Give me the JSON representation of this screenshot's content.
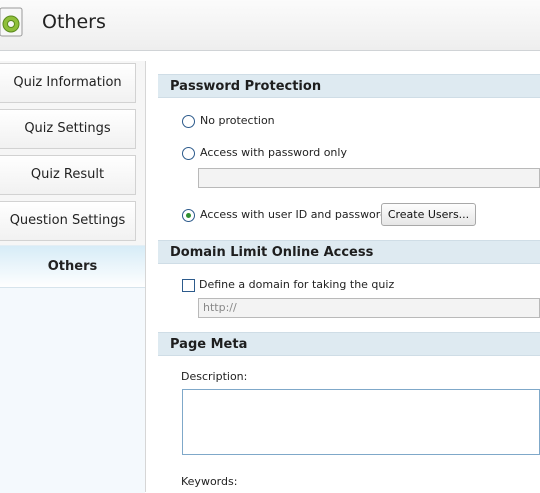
{
  "window": {
    "title": "Others",
    "icon": "gear-document-icon"
  },
  "nav": {
    "items": [
      {
        "label": "Quiz Information"
      },
      {
        "label": "Quiz Settings"
      },
      {
        "label": "Quiz Result"
      },
      {
        "label": "Question Settings"
      },
      {
        "label": "Others",
        "active": true
      }
    ]
  },
  "password_protection": {
    "header": "Password Protection",
    "options": [
      {
        "label": "No protection",
        "selected": false
      },
      {
        "label": "Access with password only",
        "selected": false
      },
      {
        "label": "Access with user ID and password",
        "selected": true
      }
    ],
    "password_value": "",
    "create_users_label": "Create Users..."
  },
  "domain_limit": {
    "header": "Domain Limit Online Access",
    "checkbox_label": "Define a domain for taking the quiz",
    "checked": false,
    "domain_value": "http://"
  },
  "page_meta": {
    "header": "Page Meta",
    "description_label": "Description:",
    "description_value": "",
    "keywords_label": "Keywords:"
  },
  "colors": {
    "section_header": "#deeaf1",
    "active_nav": "#d7ecf7",
    "radio_selected": "#2f8f2f"
  }
}
